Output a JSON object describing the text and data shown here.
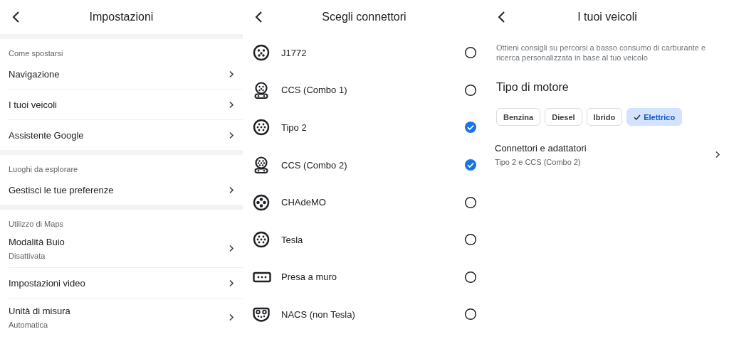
{
  "settings": {
    "title": "Impostazioni",
    "sections": [
      {
        "title": "Come spostarsi",
        "items": [
          {
            "label": "Navigazione"
          },
          {
            "label": "I tuoi veicoli"
          },
          {
            "label": "Assistente Google"
          }
        ]
      },
      {
        "title": "Luoghi da esplorare",
        "items": [
          {
            "label": "Gestisci le tue preferenze"
          }
        ]
      },
      {
        "title": "Utilizzo di Maps",
        "items": [
          {
            "label": "Modalità Buio",
            "sublabel": "Disattivata"
          },
          {
            "label": "Impostazioni video"
          },
          {
            "label": "Unità di misura",
            "sublabel": "Automatica"
          }
        ]
      }
    ]
  },
  "connectors": {
    "title": "Scegli connettori",
    "items": [
      {
        "label": "J1772",
        "kind": "j1772",
        "selected": false
      },
      {
        "label": "CCS (Combo 1)",
        "kind": "ccs1",
        "selected": false
      },
      {
        "label": "Tipo 2",
        "kind": "type2",
        "selected": true
      },
      {
        "label": "CCS (Combo 2)",
        "kind": "ccs2",
        "selected": true
      },
      {
        "label": "CHAdeMO",
        "kind": "chademo",
        "selected": false
      },
      {
        "label": "Tesla",
        "kind": "tesla",
        "selected": false
      },
      {
        "label": "Presa a muro",
        "kind": "wall",
        "selected": false
      },
      {
        "label": "NACS (non Tesla)",
        "kind": "nacs",
        "selected": false
      }
    ]
  },
  "vehicles": {
    "title": "I tuoi veicoli",
    "description": "Ottieni consigli su percorsi a basso consumo di carburante e ricerca personalizzata in base al tuo veicolo",
    "engine_heading": "Tipo di motore",
    "engine_types": [
      {
        "label": "Benzina",
        "selected": false
      },
      {
        "label": "Diesel",
        "selected": false
      },
      {
        "label": "Ibrido",
        "selected": false
      },
      {
        "label": "Elettrico",
        "selected": true
      }
    ],
    "connectors_row": {
      "label": "Connettori e adattatori",
      "value": "Tipo 2 e CCS (Combo 2)"
    }
  }
}
